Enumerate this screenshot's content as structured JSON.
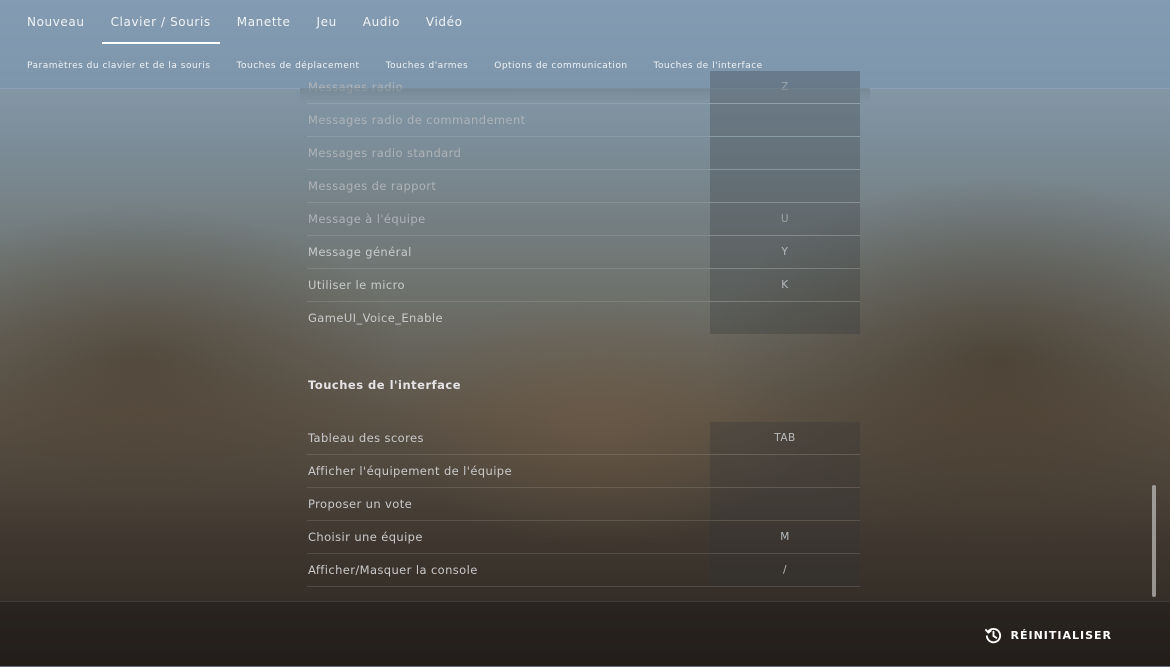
{
  "tabs": [
    {
      "label": "Nouveau"
    },
    {
      "label": "Clavier / Souris",
      "active": true
    },
    {
      "label": "Manette"
    },
    {
      "label": "Jeu"
    },
    {
      "label": "Audio"
    },
    {
      "label": "Vidéo"
    }
  ],
  "subtabs": [
    {
      "label": "Paramètres du clavier et de la souris"
    },
    {
      "label": "Touches de déplacement"
    },
    {
      "label": "Touches d'armes"
    },
    {
      "label": "Options de communication"
    },
    {
      "label": "Touches de l'interface"
    }
  ],
  "communication_rows": [
    {
      "label": "Messages radio",
      "key": "Z"
    },
    {
      "label": "Messages radio de commandement",
      "key": ""
    },
    {
      "label": "Messages radio standard",
      "key": ""
    },
    {
      "label": "Messages de rapport",
      "key": ""
    },
    {
      "label": "Message à l'équipe",
      "key": "U"
    },
    {
      "label": "Message général",
      "key": "Y"
    },
    {
      "label": "Utiliser le micro",
      "key": "K"
    },
    {
      "label": "GameUI_Voice_Enable",
      "key": ""
    }
  ],
  "interface_section": {
    "title": "Touches de l'interface",
    "rows": [
      {
        "label": "Tableau des scores",
        "key": "TAB"
      },
      {
        "label": "Afficher l'équipement de l'équipe",
        "key": ""
      },
      {
        "label": "Proposer un vote",
        "key": ""
      },
      {
        "label": "Choisir une équipe",
        "key": "M"
      },
      {
        "label": "Afficher/Masquer la console",
        "key": "/"
      }
    ]
  },
  "footer": {
    "reset_label": "RÉINITIALISER",
    "reset_icon": "reset-history-icon"
  }
}
